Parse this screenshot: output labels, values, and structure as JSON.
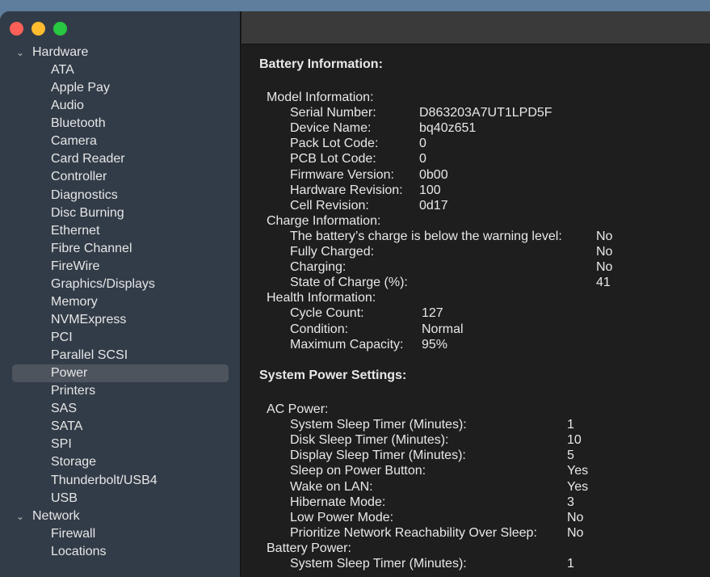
{
  "sidebar": {
    "categories": [
      {
        "label": "Hardware",
        "items": [
          "ATA",
          "Apple Pay",
          "Audio",
          "Bluetooth",
          "Camera",
          "Card Reader",
          "Controller",
          "Diagnostics",
          "Disc Burning",
          "Ethernet",
          "Fibre Channel",
          "FireWire",
          "Graphics/Displays",
          "Memory",
          "NVMExpress",
          "PCI",
          "Parallel SCSI",
          "Power",
          "Printers",
          "SAS",
          "SATA",
          "SPI",
          "Storage",
          "Thunderbolt/USB4",
          "USB"
        ]
      },
      {
        "label": "Network",
        "items": [
          "Firewall",
          "Locations"
        ]
      }
    ],
    "selected": "Power"
  },
  "content": {
    "battery_title": "Battery Information:",
    "groups": [
      {
        "label": "Model Information:",
        "valx": 220,
        "rows": [
          [
            "Serial Number:",
            "D863203A7UT1LPD5F"
          ],
          [
            "Device Name:",
            "bq40z651"
          ],
          [
            "Pack Lot Code:",
            "0"
          ],
          [
            "PCB Lot Code:",
            "0"
          ],
          [
            "Firmware Version:",
            "0b00"
          ],
          [
            "Hardware Revision:",
            "100"
          ],
          [
            "Cell Revision:",
            "0d17"
          ]
        ]
      },
      {
        "label": "Charge Information:",
        "valx": 439,
        "rows": [
          [
            "The battery’s charge is below the warning level:",
            "No"
          ],
          [
            "Fully Charged:",
            "No"
          ],
          [
            "Charging:",
            "No"
          ],
          [
            "State of Charge (%):",
            "41"
          ]
        ]
      },
      {
        "label": "Health Information:",
        "valx": 223,
        "rows": [
          [
            "Cycle Count:",
            "127"
          ],
          [
            "Condition:",
            "Normal"
          ],
          [
            "Maximum Capacity:",
            "95%"
          ]
        ]
      }
    ],
    "power_title": "System Power Settings:",
    "power_groups": [
      {
        "label": "AC Power:",
        "valx": 403,
        "rows": [
          [
            "System Sleep Timer (Minutes):",
            "1"
          ],
          [
            "Disk Sleep Timer (Minutes):",
            "10"
          ],
          [
            "Display Sleep Timer (Minutes):",
            "5"
          ],
          [
            "Sleep on Power Button:",
            "Yes"
          ],
          [
            "Wake on LAN:",
            "Yes"
          ],
          [
            "Hibernate Mode:",
            "3"
          ],
          [
            "Low Power Mode:",
            "No"
          ],
          [
            "Prioritize Network Reachability Over Sleep:",
            "No"
          ]
        ]
      },
      {
        "label": "Battery Power:",
        "valx": 403,
        "rows": [
          [
            "System Sleep Timer (Minutes):",
            "1"
          ]
        ]
      }
    ]
  }
}
